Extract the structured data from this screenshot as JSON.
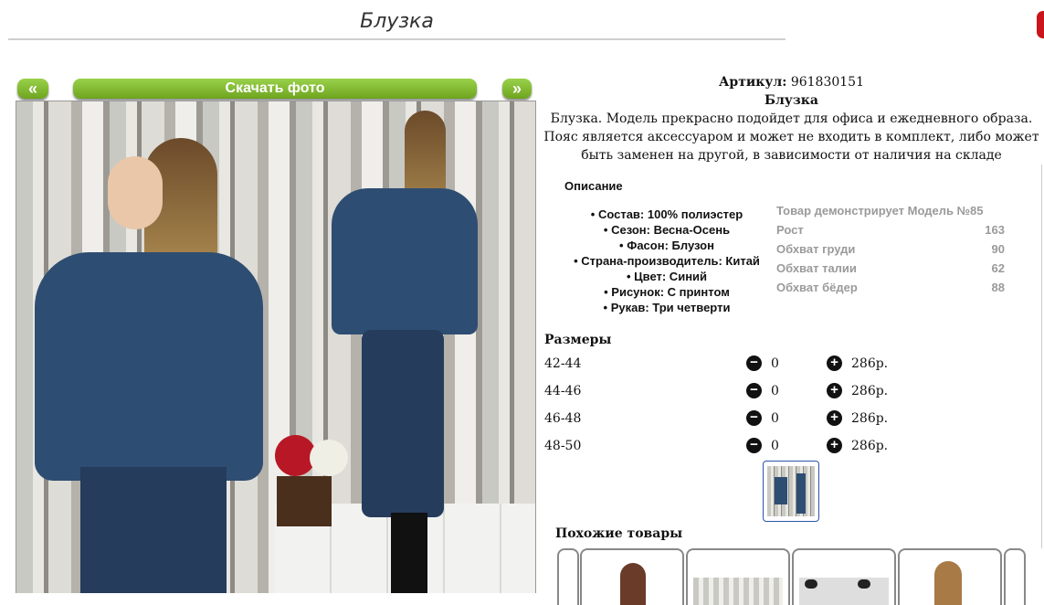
{
  "page": {
    "title": "Блузка"
  },
  "nav": {
    "prev": "«",
    "download": "Скачать фото",
    "next": "»"
  },
  "product": {
    "article_label": "Артикул:",
    "article_value": "961830151",
    "name": "Блузка",
    "description": "Блузка. Модель прекрасно подойдет для офиса и ежедневного образа. Пояс является аксессуаром и может не входить в комплект, либо может быть заменен на другой, в зависимости от наличия на складе"
  },
  "description_heading": "Описание",
  "properties": [
    "Состав: 100% полиэстер",
    "Сезон: Весна-Осень",
    "Фасон: Блузон",
    "Страна-производитель: Китай",
    "Цвет: Синий",
    "Рисунок: С принтом",
    "Рукав: Три четверти"
  ],
  "model": {
    "heading": "Товар демонстрирует Модель №85",
    "rows": [
      {
        "label": "Рост",
        "value": "163"
      },
      {
        "label": "Обхват груди",
        "value": "90"
      },
      {
        "label": "Обхват талии",
        "value": "62"
      },
      {
        "label": "Обхват бёдер",
        "value": "88"
      }
    ]
  },
  "sizes_heading": "Размеры",
  "sizes": [
    {
      "size": "42-44",
      "qty": "0",
      "price": "286р."
    },
    {
      "size": "44-46",
      "qty": "0",
      "price": "286р."
    },
    {
      "size": "46-48",
      "qty": "0",
      "price": "286р."
    },
    {
      "size": "48-50",
      "qty": "0",
      "price": "286р."
    }
  ],
  "similar_heading": "Похожие товары",
  "icons": {
    "minus": "minus-circle-icon",
    "plus": "plus-circle-icon"
  },
  "colors": {
    "accent_green": "#7cb82f",
    "red_corner": "#c9151b",
    "thumb_border": "#2a55a8"
  }
}
